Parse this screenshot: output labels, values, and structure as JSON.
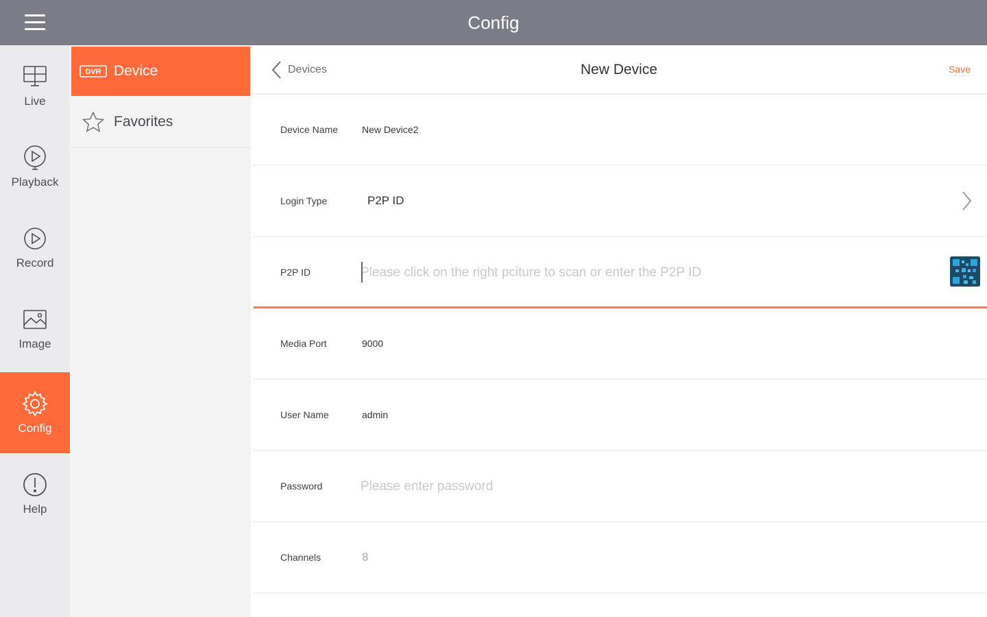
{
  "topbar": {
    "title": "Config"
  },
  "leftnav": {
    "items": [
      {
        "label": "Live",
        "icon": "monitor-icon"
      },
      {
        "label": "Playback",
        "icon": "playback-icon"
      },
      {
        "label": "Record",
        "icon": "record-icon"
      },
      {
        "label": "Image",
        "icon": "image-icon"
      },
      {
        "label": "Config",
        "icon": "gear-icon",
        "active": true
      },
      {
        "label": "Help",
        "icon": "help-icon"
      }
    ]
  },
  "submenu": {
    "items": [
      {
        "label": "Device",
        "icon": "dvr-icon",
        "icon_text": "DVR",
        "active": true
      },
      {
        "label": "Favorites",
        "icon": "star-icon"
      }
    ]
  },
  "main": {
    "back_label": "Devices",
    "title": "New Device",
    "save_label": "Save",
    "fields": {
      "device_name": {
        "label": "Device Name",
        "value": "New Device2"
      },
      "login_type": {
        "label": "Login Type",
        "value": "P2P ID"
      },
      "p2p_id": {
        "label": "P2P ID",
        "value": "",
        "placeholder": "Please click on the right pciture to scan or enter the P2P ID"
      },
      "media_port": {
        "label": "Media Port",
        "value": "9000"
      },
      "user_name": {
        "label": "User Name",
        "value": "admin"
      },
      "password": {
        "label": "Password",
        "value": "",
        "placeholder": "Please enter password"
      },
      "channels": {
        "label": "Channels",
        "value": "8"
      }
    }
  },
  "colors": {
    "accent": "#fe6a3a",
    "topbar": "#7b7c87",
    "nav_bg": "#ebebee",
    "submenu_bg": "#f4f4f5"
  }
}
